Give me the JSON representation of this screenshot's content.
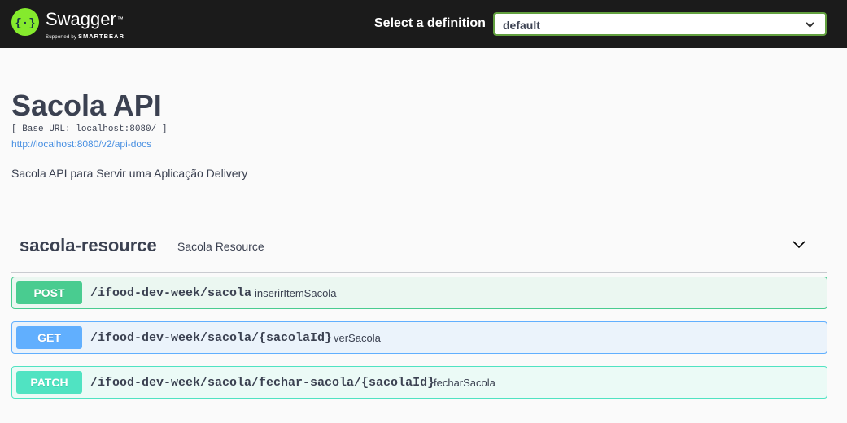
{
  "header": {
    "brand": "Swagger",
    "trademark": "™",
    "supported_by": "Supported by",
    "supported_company": "SMARTBEAR",
    "select_label": "Select a definition",
    "select_value": "default",
    "logo_icon": "swagger-braces-icon",
    "accent_color": "#85ea2d",
    "select_border_color": "#62a03f"
  },
  "info": {
    "title": "Sacola API",
    "base_url": "[ Base URL: localhost:8080/ ]",
    "docs_url": "http://localhost:8080/v2/api-docs",
    "description": "Sacola API para Servir uma Aplicação Delivery"
  },
  "tag": {
    "name": "sacola-resource",
    "description": "Sacola Resource",
    "expand_icon": "chevron-down-icon"
  },
  "operations": [
    {
      "method": "POST",
      "path": "/ifood-dev-week/sacola",
      "summary": "inserirItemSacola",
      "color": "#49cc90"
    },
    {
      "method": "GET",
      "path": "/ifood-dev-week/sacola/{sacolaId}",
      "summary": "verSacola",
      "color": "#61affe"
    },
    {
      "method": "PATCH",
      "path": "/ifood-dev-week/sacola/fechar-sacola/{sacolaId}",
      "summary": "fecharSacola",
      "color": "#50e3c2"
    }
  ]
}
